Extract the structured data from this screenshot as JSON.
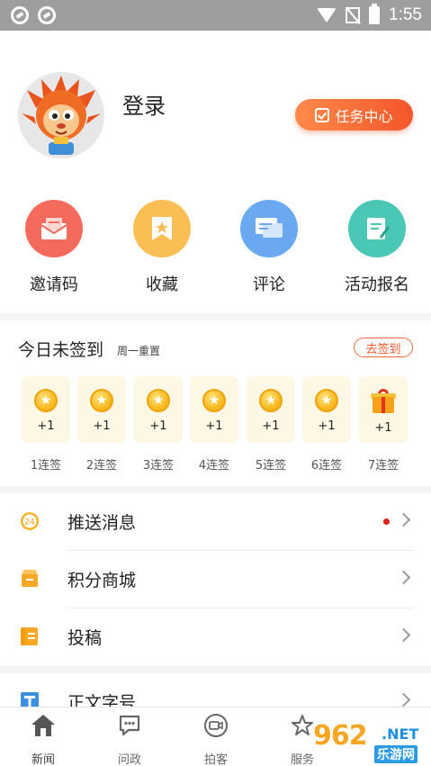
{
  "status_bar": {
    "time": "1:55"
  },
  "profile": {
    "login_label": "登录",
    "task_center_label": "任务中心"
  },
  "quick_actions": [
    {
      "label": "邀请码",
      "icon": "invite-mail-icon",
      "color": "#f46a5c"
    },
    {
      "label": "收藏",
      "icon": "bookmark-icon",
      "color": "#fbbe55"
    },
    {
      "label": "评论",
      "icon": "comment-icon",
      "color": "#6aa9ef"
    },
    {
      "label": "活动报名",
      "icon": "signup-form-icon",
      "color": "#4ac7b5"
    }
  ],
  "sign_in": {
    "title": "今日未签到",
    "subtitle": "周一重置",
    "button_label": "去签到",
    "days": [
      {
        "reward": "+1",
        "label": "1连签",
        "icon": "coin-icon"
      },
      {
        "reward": "+1",
        "label": "2连签",
        "icon": "coin-icon"
      },
      {
        "reward": "+1",
        "label": "3连签",
        "icon": "coin-icon"
      },
      {
        "reward": "+1",
        "label": "4连签",
        "icon": "coin-icon"
      },
      {
        "reward": "+1",
        "label": "5连签",
        "icon": "coin-icon"
      },
      {
        "reward": "+1",
        "label": "6连签",
        "icon": "coin-icon"
      },
      {
        "reward": "+1",
        "label": "7连签",
        "icon": "gift-icon"
      }
    ]
  },
  "menu": [
    {
      "label": "推送消息",
      "icon": "push-24-icon",
      "badge_text": "24",
      "has_red_dot": true
    },
    {
      "label": "积分商城",
      "icon": "shop-icon"
    },
    {
      "label": "投稿",
      "icon": "contribute-icon"
    },
    {
      "label": "正文字号",
      "icon": "font-size-icon"
    }
  ],
  "bottom_nav": [
    {
      "label": "新闻",
      "icon": "home-icon"
    },
    {
      "label": "问政",
      "icon": "chat-icon"
    },
    {
      "label": "拍客",
      "icon": "video-icon"
    },
    {
      "label": "服务",
      "icon": "star-service-icon"
    }
  ],
  "watermark": {
    "main": "962",
    "net": ".NET",
    "sub": "乐游网"
  },
  "colors": {
    "accent": "#f2562a",
    "status_bar": "#9e9e9e",
    "coin": "#f7b518"
  }
}
